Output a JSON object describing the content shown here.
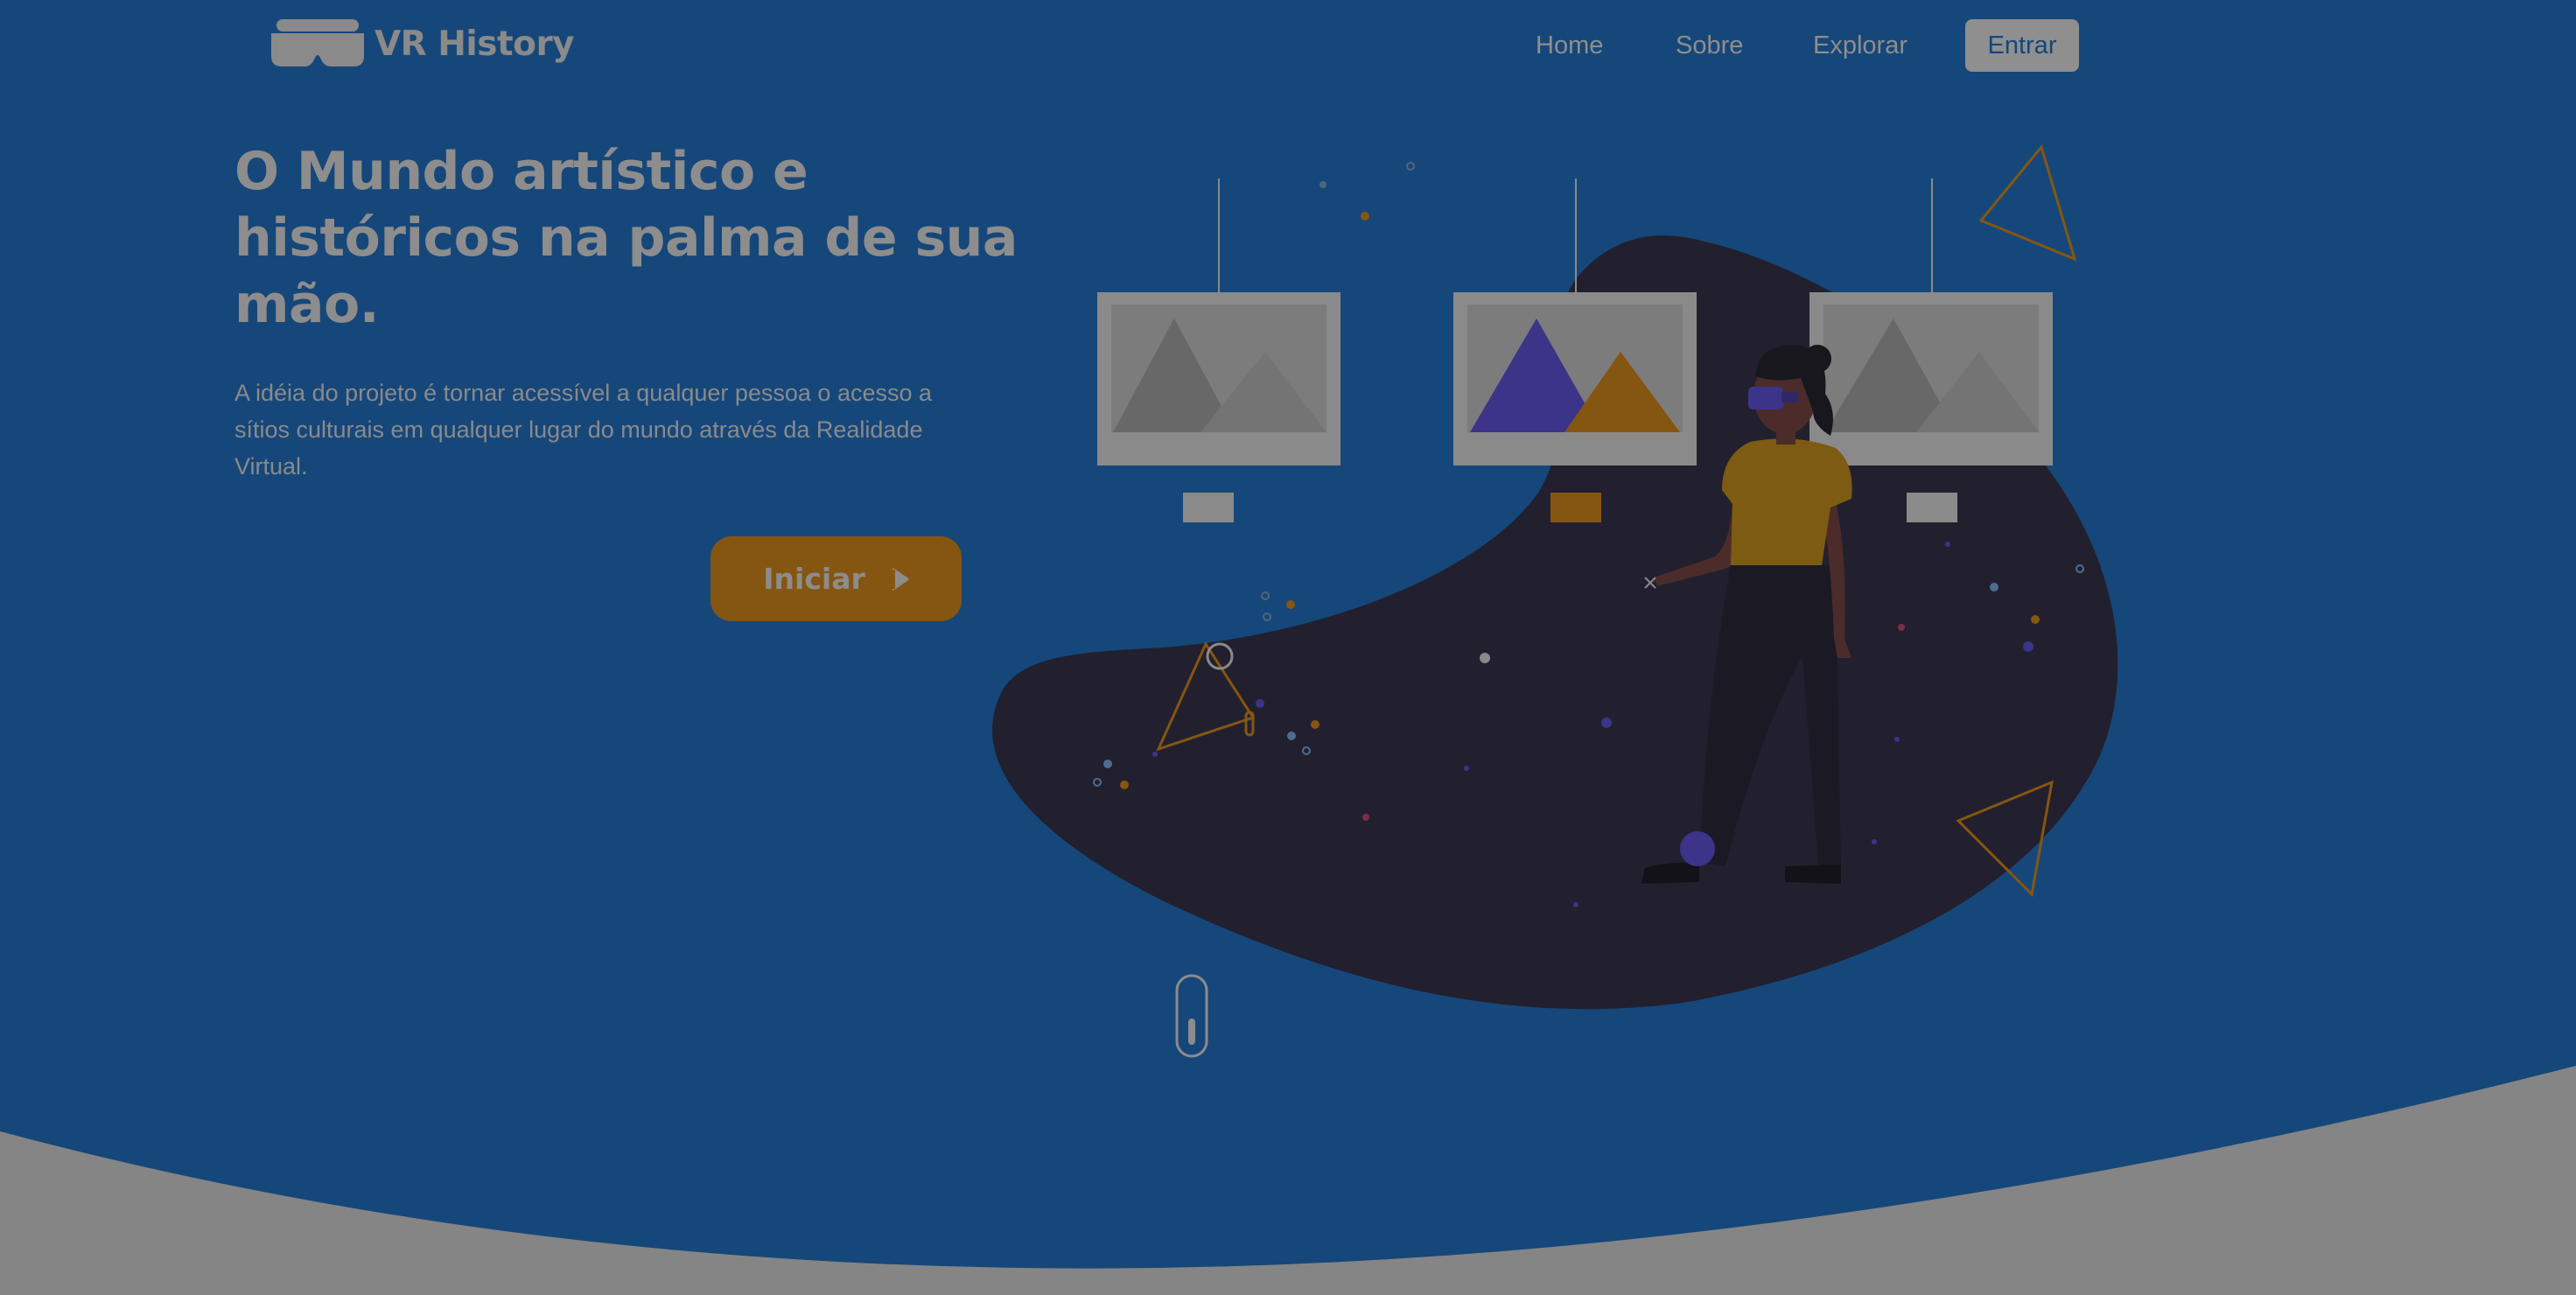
{
  "brand": {
    "name": "VR History",
    "icon": "vr-headset-icon"
  },
  "nav": {
    "links": [
      {
        "label": "Home"
      },
      {
        "label": "Sobre"
      },
      {
        "label": "Explorar"
      }
    ],
    "login_label": "Entrar"
  },
  "hero": {
    "title": "O Mundo artístico e históricos na palma de sua mão.",
    "description": "A idéia do projeto é tornar acessível a qualquer pessoa o acesso a sítios culturais em qualquer lugar do mundo através da Realidade Virtual.",
    "cta_label": "Iniciar",
    "cta_icon": "play-icon"
  },
  "illustration": {
    "subject": "vr-museum-illustration"
  },
  "scroll_indicator": {
    "icon": "mouse-scroll-icon"
  },
  "colors": {
    "background": "#16477a",
    "accent": "#855611",
    "blob": "#22202e",
    "text_muted": "#8c8c8c",
    "purple": "#3c3489",
    "footer_curve": "#858585"
  }
}
